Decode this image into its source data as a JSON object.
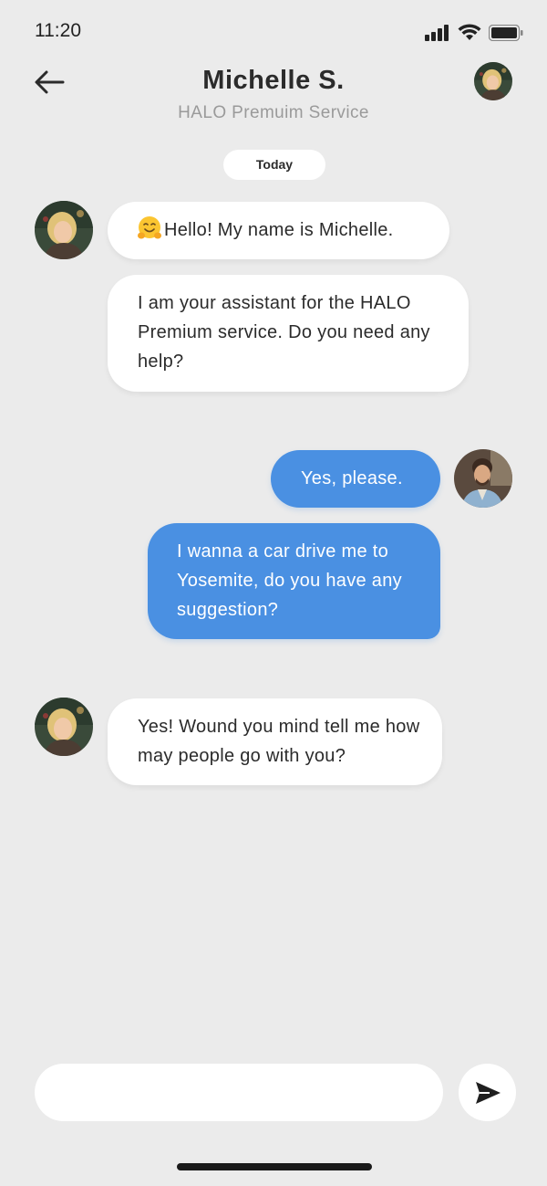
{
  "status_bar": {
    "time": "11:20"
  },
  "header": {
    "title": "Michelle S.",
    "subtitle": "HALO Premuim Service"
  },
  "date_separator": "Today",
  "messages": [
    {
      "sender": "agent",
      "text": "Hello! My name is Michelle.",
      "emoji": "hugging-face"
    },
    {
      "sender": "agent",
      "text": "I am your assistant for the HALO Premium service. Do you need any help?"
    },
    {
      "sender": "user",
      "text": "Yes, please."
    },
    {
      "sender": "user",
      "text": "I wanna a car drive me to Yosemite, do you have any suggestion?"
    },
    {
      "sender": "agent",
      "text": "Yes! Wound you mind tell me how may people go with you?"
    }
  ],
  "composer": {
    "value": "",
    "placeholder": ""
  },
  "colors": {
    "background": "#ebebeb",
    "incoming_bubble": "#ffffff",
    "outgoing_bubble": "#4a90e2",
    "text": "#2b2b2b",
    "subtitle": "#9a9a9a"
  },
  "icons": [
    "back-arrow-icon",
    "signal-icon",
    "wifi-icon",
    "battery-icon",
    "send-icon"
  ]
}
